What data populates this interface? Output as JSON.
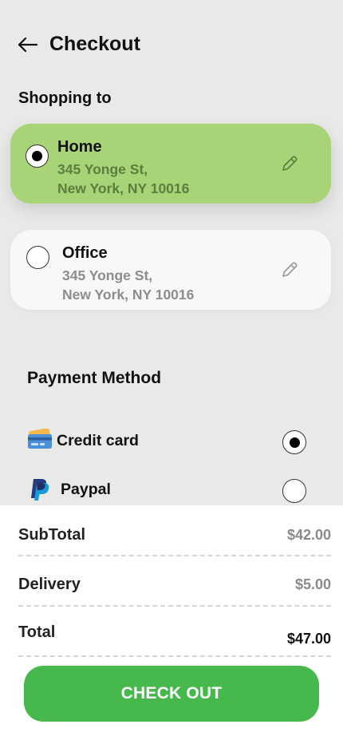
{
  "header": {
    "title": "Checkout",
    "back_icon": "arrow-left-icon"
  },
  "shipping": {
    "title": "Shopping to",
    "addresses": [
      {
        "name": "Home",
        "line1": "345 Yonge St,",
        "line2": "New York, NY 10016",
        "selected": true,
        "edit_icon": "pencil-icon"
      },
      {
        "name": "Office",
        "line1": "345 Yonge St,",
        "line2": "New York, NY 10016",
        "selected": false,
        "edit_icon": "pencil-icon"
      }
    ]
  },
  "payment": {
    "title": "Payment Method",
    "methods": [
      {
        "label": "Credit card",
        "icon": "credit-card-icon",
        "selected": true
      },
      {
        "label": "Paypal",
        "icon": "paypal-icon",
        "selected": false
      }
    ]
  },
  "summary": {
    "subtotal_label": "SubTotal",
    "subtotal_value": "$42.00",
    "delivery_label": "Delivery",
    "delivery_value": "$5.00",
    "total_label": "Total",
    "total_value": "$47.00"
  },
  "checkout_button": "CHECK OUT",
  "colors": {
    "background": "#e9e9e8",
    "selected_card": "#a8d377",
    "accent_green": "#47b94c",
    "muted_text": "#8d8d8d"
  }
}
